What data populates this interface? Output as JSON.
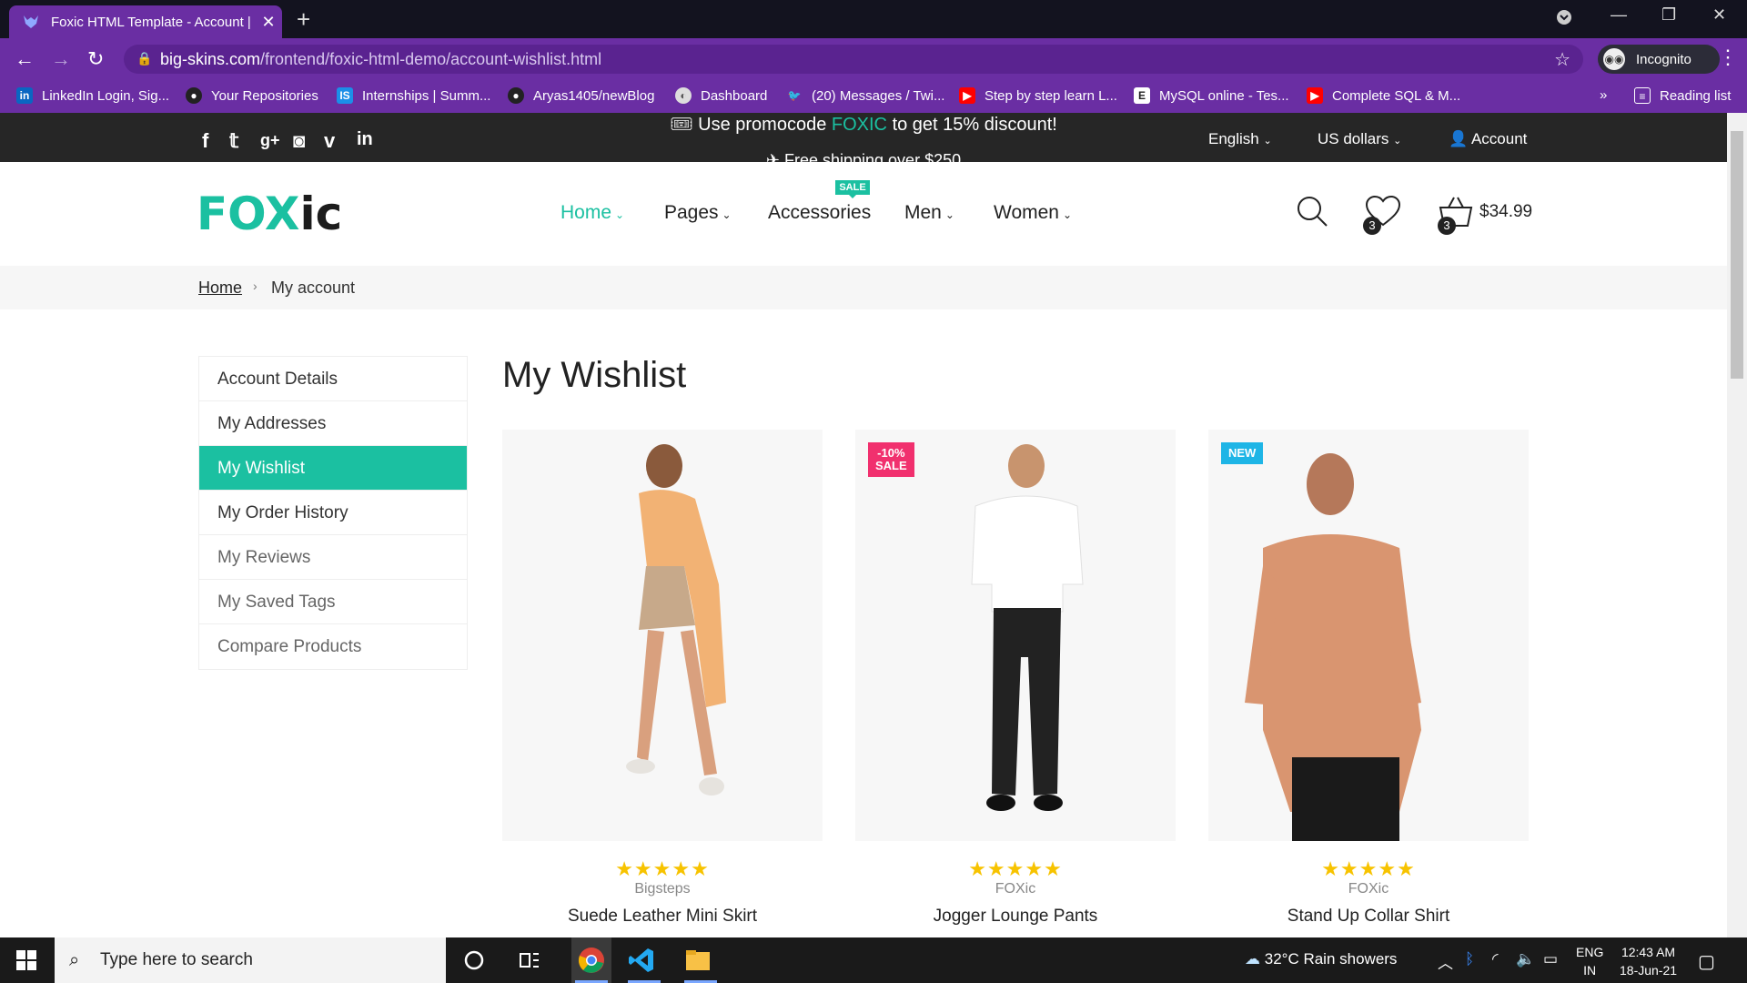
{
  "browser": {
    "tab_title": "Foxic HTML Template - Account |",
    "url_host": "big-skins.com",
    "url_path": "/frontend/foxic-html-demo/account-wishlist.html",
    "incognito_label": "Incognito",
    "reading_list_label": "Reading list",
    "bookmarks": [
      {
        "label": "LinkedIn Login, Sig...",
        "icon": "linkedin-icon",
        "color": "#0a66c2"
      },
      {
        "label": "Your Repositories",
        "icon": "github-icon",
        "color": "#222222"
      },
      {
        "label": "Internships | Summ...",
        "icon": "internshala-icon",
        "color": "#1b8fe8"
      },
      {
        "label": "Aryas1405/newBlog",
        "icon": "github-icon",
        "color": "#222222"
      },
      {
        "label": "Dashboard",
        "icon": "globe-icon",
        "color": "#dddddd"
      },
      {
        "label": "(20) Messages / Twi...",
        "icon": "twitter-icon",
        "color": "#1da1f2"
      },
      {
        "label": "Step by step learn L...",
        "icon": "youtube-icon",
        "color": "#ff0000"
      },
      {
        "label": "MySQL online - Tes...",
        "icon": "e-icon",
        "color": "#222222"
      },
      {
        "label": "Complete SQL & M...",
        "icon": "youtube-icon",
        "color": "#ff0000"
      }
    ]
  },
  "topbar": {
    "promo_pre": "Use promocode ",
    "promo_code": "FOXIC",
    "promo_post": " to get 15% discount!",
    "promo2": "Free shipping over $250",
    "language": "English",
    "currency": "US dollars",
    "account": "Account"
  },
  "header": {
    "logo_a": "FOX",
    "logo_b": "ic",
    "nav": [
      {
        "label": "Home",
        "active": true
      },
      {
        "label": "Pages"
      },
      {
        "label": "Accessories",
        "badge": "SALE"
      },
      {
        "label": "Men"
      },
      {
        "label": "Women"
      }
    ],
    "wishlist_count": "3",
    "cart_count": "3",
    "cart_total": "$34.99"
  },
  "breadcrumb": {
    "home": "Home",
    "current": "My account"
  },
  "sidebar": [
    {
      "label": "Account Details"
    },
    {
      "label": "My Addresses"
    },
    {
      "label": "My Wishlist",
      "active": true
    },
    {
      "label": "My Order History"
    },
    {
      "label": "My Reviews"
    },
    {
      "label": "My Saved Tags"
    },
    {
      "label": "Compare Products"
    }
  ],
  "page_title": "My Wishlist",
  "products": [
    {
      "name": "Suede Leather Mini Skirt",
      "brand": "Bigsteps",
      "stars": "★★★★★",
      "badge": ""
    },
    {
      "name": "Jogger Lounge Pants",
      "brand": "FOXic",
      "stars": "★★★★★",
      "badge": "-10%\nSALE",
      "badge_color": "#f1306e"
    },
    {
      "name": "Stand Up Collar Shirt",
      "brand": "FOXic",
      "stars": "★★★★★",
      "badge": "NEW",
      "badge_color": "#1eb5e6"
    }
  ],
  "taskbar": {
    "search_placeholder": "Type here to search",
    "weather": "32°C  Rain showers",
    "lang1": "ENG",
    "lang2": "IN",
    "time": "12:43 AM",
    "date": "18-Jun-21"
  },
  "colors": {
    "accent": "#1bc0a1",
    "chrome": "#6a2ea3"
  }
}
